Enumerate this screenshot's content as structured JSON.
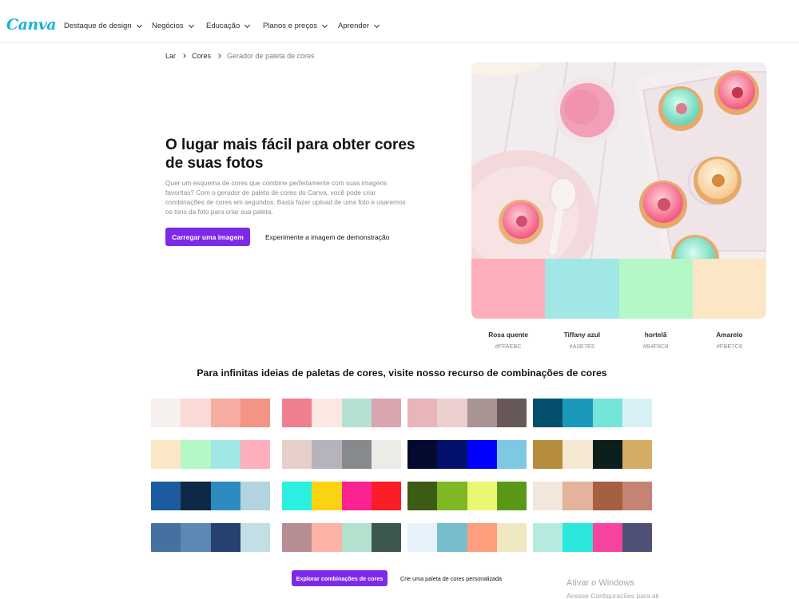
{
  "nav": {
    "logo": "Canva",
    "items": [
      {
        "label": "Destaque de design"
      },
      {
        "label": "Negócios"
      },
      {
        "label": "Educação"
      },
      {
        "label": "Planos e preços"
      },
      {
        "label": "Aprender"
      }
    ]
  },
  "breadcrumb": [
    "Lar",
    "Cores",
    "Gerador de paleta de cores"
  ],
  "hero": {
    "title": "O lugar mais fácil para obter cores de suas fotos",
    "description": "Quer um esquema de cores que combine perfeitamente com suas imagens favoritas? Com o gerador de paleta de cores do Canva, você pode criar combinações de cores em segundos. Basta fazer upload de uma foto e usaremos os tons da foto para criar sua paleta.",
    "upload_button": "Carregar uma imagem",
    "demo_link": "Experimente a imagem de demonstração"
  },
  "extracted_palette": [
    {
      "name": "Rosa quente",
      "hex": "#FFAEBC"
    },
    {
      "name": "Tiffany azul",
      "hex": "#A0E7E5"
    },
    {
      "name": "hortelã",
      "hex": "#B4F8C8"
    },
    {
      "name": "Amarelo",
      "hex": "#FBE7C6"
    }
  ],
  "combinations": {
    "title": "Para infinitas ideias de paletas de cores, visite nosso recurso de combinações de cores",
    "palettes": [
      [
        "#F6F0EE",
        "#FADAD6",
        "#F6ACA0",
        "#F49486"
      ],
      [
        "#F07E91",
        "#FBE8E2",
        "#B4E1D2",
        "#D9A6B0"
      ],
      [
        "#E8B5B8",
        "#EBCFCF",
        "#A89492",
        "#685859"
      ],
      [
        "#034F6E",
        "#1A99BB",
        "#75E4DB",
        "#D7F1F5"
      ],
      [
        "#FBE7C6",
        "#B4F8C8",
        "#A0E7E5",
        "#FFAEBC"
      ],
      [
        "#E8D0CA",
        "#B6B3BC",
        "#878A8C",
        "#EDEBE6"
      ],
      [
        "#04092E",
        "#020F6B",
        "#0000FF",
        "#7EC8E3"
      ],
      [
        "#B58D3D",
        "#F6E9D3",
        "#0D1F1C",
        "#D4AC64"
      ],
      [
        "#1B5C9E",
        "#0E2946",
        "#2E8BC0",
        "#B1D4E0"
      ],
      [
        "#2BF0DF",
        "#FAD412",
        "#FC2391",
        "#FA1C27"
      ],
      [
        "#3D5B13",
        "#7EB824",
        "#EBF774",
        "#5A9918"
      ],
      [
        "#F4E7DC",
        "#E3B39C",
        "#A65F40",
        "#C58472"
      ],
      [
        "#4571A1",
        "#5C88B5",
        "#26416F",
        "#C2DFE5"
      ],
      [
        "#B78D94",
        "#FEB3A7",
        "#B2E1CE",
        "#3E5650"
      ],
      [
        "#E6F2F9",
        "#76BDCB",
        "#FE9E7C",
        "#F0E8C2"
      ],
      [
        "#B6EADF",
        "#2BE8DC",
        "#F8449E",
        "#4E5175"
      ]
    ],
    "explore_button": "Explorar combinações de cores",
    "create_link": "Crie uma paleta de cores personalizada"
  },
  "watermark": {
    "title": "Ativar o Windows",
    "subtitle": "Acesse Configurações para ati"
  }
}
